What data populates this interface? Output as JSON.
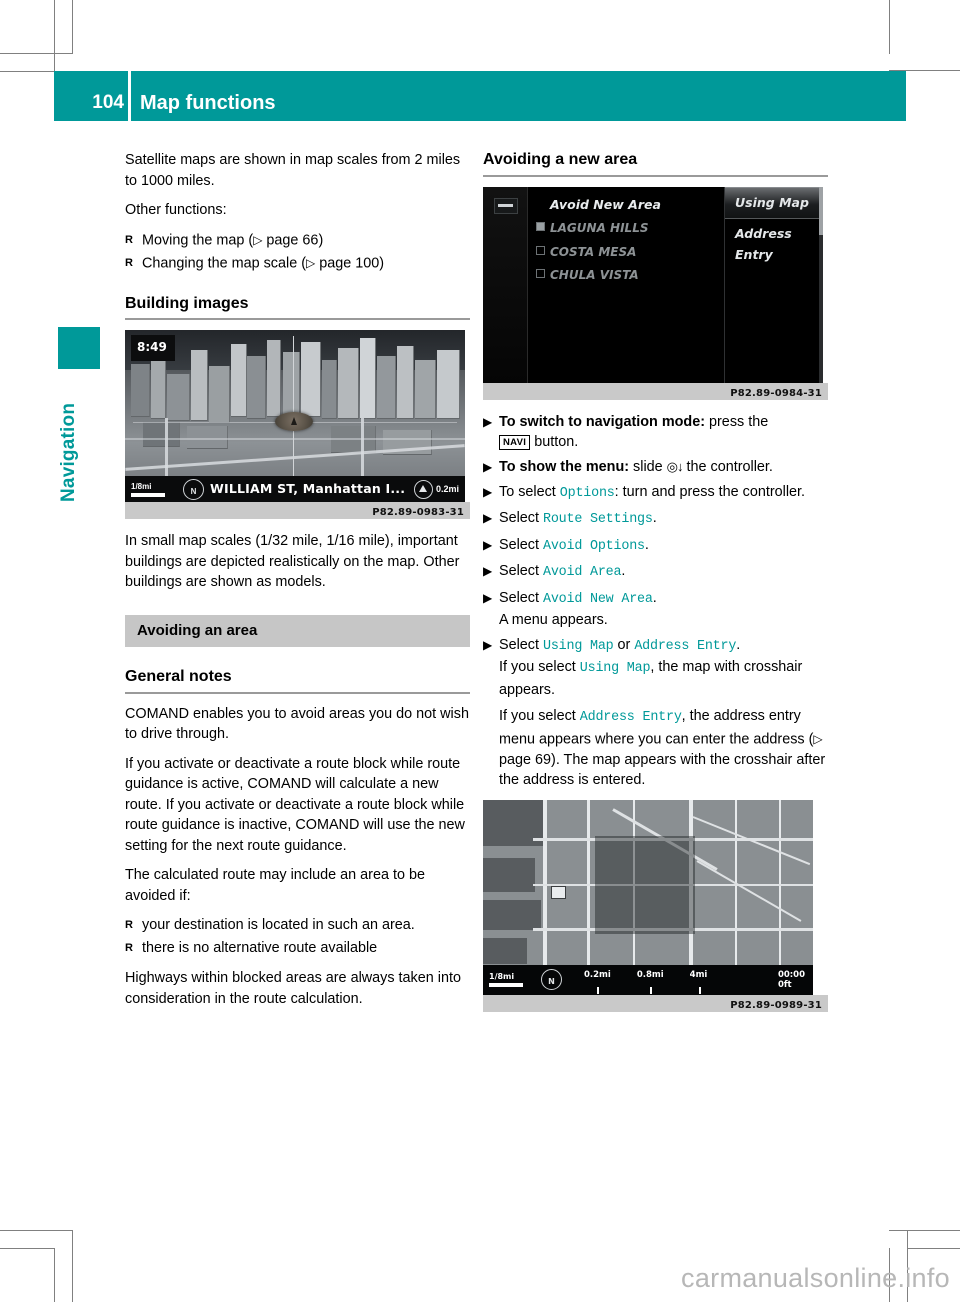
{
  "page": {
    "number": "104",
    "title": "Map functions",
    "side_tab": "Navigation",
    "watermark": "carmanualsonline.info",
    "accent_color": "#009999",
    "band_color": "#c6c6c6"
  },
  "left_column": {
    "intro_paragraph": "Satellite maps are shown in map scales from 2 miles to 1000 miles.",
    "other_functions_label": "Other functions:",
    "other_functions": [
      {
        "text": "Moving the map (",
        "ref": " page 66",
        "tail": ")"
      },
      {
        "text": "Changing the map scale (",
        "ref": " page 100",
        "tail": ")"
      }
    ],
    "building_images_heading": "Building images",
    "building_figure": {
      "time": "8:49",
      "scale_label": "1/8mi",
      "street": "WILLIAM ST, Manhattan I...",
      "distance": "0.2mi",
      "caption": "P82.89-0983-31"
    },
    "building_paragraph": "In small map scales (1/32 mile, 1/16 mile), important buildings are depicted realistically on the map. Other buildings are shown as models.",
    "avoiding_area_band": "Avoiding an area",
    "general_notes_heading": "General notes",
    "general_notes_p1": "COMAND enables you to avoid areas you do not wish to drive through.",
    "general_notes_p2": "If you activate or deactivate a route block while route guidance is active, COMAND will calculate a new route. If you activate or deactivate a route block while route guidance is inactive, COMAND will use the new setting for the next route guidance.",
    "general_notes_p3": "The calculated route may include an area to be avoided if:",
    "general_notes_bullets": [
      "your destination is located in such an area.",
      "there is no alternative route available"
    ],
    "general_notes_p4": "Highways within blocked areas are always taken into consideration in the route calculation."
  },
  "right_column": {
    "heading": "Avoiding a new area",
    "menu_figure": {
      "title": "Avoid New Area",
      "entries": [
        {
          "label": "LAGUNA HILLS",
          "checked": true
        },
        {
          "label": "COSTA MESA",
          "checked": false
        },
        {
          "label": "CHULA VISTA",
          "checked": false
        }
      ],
      "side_items": [
        {
          "label": "Using Map",
          "selected": true
        },
        {
          "label": "Address Entry",
          "selected": false
        }
      ],
      "back_icon": "back-arrow-icon",
      "caption": "P82.89-0984-31"
    },
    "steps": [
      {
        "bold_lead": "To switch to navigation mode:",
        "text_after": " press the",
        "key": "NAVI",
        "text_tail": " button."
      },
      {
        "bold_lead": "To show the menu:",
        "text_after": " slide",
        "glyph": "◎↓",
        "text_tail": " the controller."
      },
      {
        "text_before": "To select ",
        "mono": "Options",
        "text_tail": ": turn and press the controller."
      },
      {
        "text_before": "Select ",
        "mono": "Route Settings",
        "text_tail": "."
      },
      {
        "text_before": "Select ",
        "mono": "Avoid Options",
        "text_tail": "."
      },
      {
        "text_before": "Select ",
        "mono": "Avoid Area",
        "text_tail": "."
      },
      {
        "text_before": "Select ",
        "mono": "Avoid New Area",
        "text_tail": ".",
        "sub": "A menu appears."
      },
      {
        "text_before": "Select ",
        "mono": "Using Map",
        "mid": " or ",
        "mono2": "Address Entry",
        "text_tail": ".",
        "sub_pre": "If you select ",
        "sub_mono": "Using Map",
        "sub_post": ", the map with crosshair appears."
      }
    ],
    "address_note": {
      "pre": "If you select ",
      "mono": "Address Entry",
      "mid": ", the address entry menu appears where you can enter the address (",
      "ref": " page 69",
      "post": "). The map appears with the crosshair after the address is entered."
    },
    "map_figure": {
      "scale_label": "1/8mi",
      "ticks": [
        "0.2mi",
        "0.8mi",
        "4mi"
      ],
      "eta_time": "00:00",
      "eta_dist": "0ft",
      "caption": "P82.89-0989-31"
    }
  }
}
